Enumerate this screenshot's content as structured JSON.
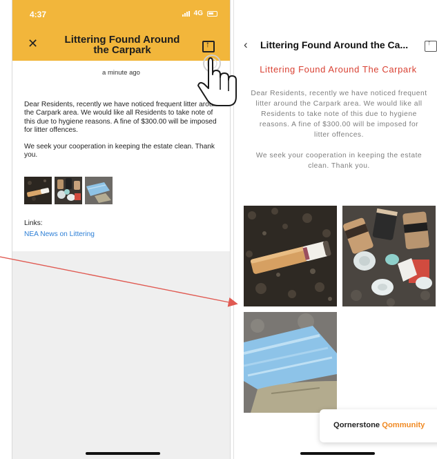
{
  "left_phone": {
    "status": {
      "time": "4:37",
      "network": "4G"
    },
    "header": {
      "title": "Littering Found Around the Carpark"
    },
    "timestamp": "a minute ago",
    "body": [
      "Dear Residents, recently we have noticed frequent litter around the Carpark area. We would like all Residents to take note of this due to hygiene reasons. A fine of $300.00 will be imposed for litter offences.",
      "We seek your cooperation in keeping the estate clean. Thank you."
    ],
    "thumbnails": [
      "cigarette-butt",
      "coffee-cups-litter",
      "face-mask-litter"
    ],
    "links_label": "Links:",
    "link": "NEA News on Littering"
  },
  "right_phone": {
    "nav_title": "Littering Found Around the Ca...",
    "title": "Littering Found Around The Carpark",
    "body": [
      "Dear Residents, recently we have noticed frequent litter around the Carpark area. We would like all Residents to take note of this due to hygiene reasons. A fine of $300.00 will be imposed for litter offences.",
      "We seek your cooperation in keeping the estate clean. Thank you."
    ],
    "images": [
      "cigarette-butt",
      "coffee-cups-litter",
      "face-mask-litter"
    ],
    "brand": {
      "part1": "Qornerstone",
      "part2": "Qommunity"
    }
  },
  "colors": {
    "header_yellow": "#f2b63b",
    "title_red": "#d94032",
    "link_blue": "#2d7fd6",
    "brand_orange": "#f08a24",
    "arrow_red": "#e05a52"
  }
}
